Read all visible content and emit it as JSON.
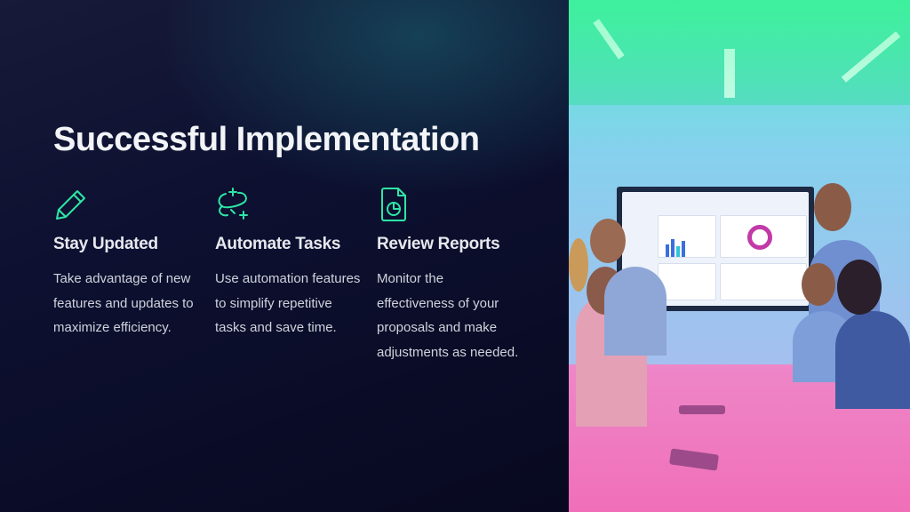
{
  "slide": {
    "title": "Successful Implementation",
    "accent_color": "#2ee6a6",
    "features": [
      {
        "icon": "pencil-icon",
        "heading": "Stay Updated",
        "text": "Take advantage of new features and updates to maximize efficiency."
      },
      {
        "icon": "sparkle-automation-icon",
        "heading": "Automate Tasks",
        "text": "Use automation features to simplify repetitive tasks and save time."
      },
      {
        "icon": "report-document-icon",
        "heading": "Review Reports",
        "text": "Monitor the effectiveness of your proposals and make adjustments as needed."
      }
    ]
  },
  "photo": {
    "subject": "team-meeting-photo"
  }
}
